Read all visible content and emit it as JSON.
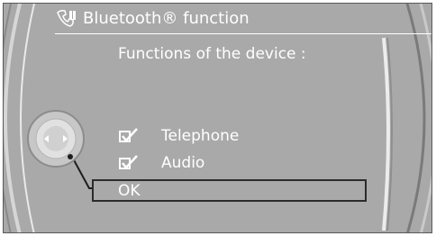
{
  "header": {
    "title": "Bluetooth® function",
    "icon": "phone-settings-icon"
  },
  "subtitle": "Functions of the device :",
  "options": [
    {
      "label": "Telephone",
      "checked": true,
      "icon": "checkbox-checked-icon"
    },
    {
      "label": "Audio",
      "checked": true,
      "icon": "checkbox-checked-icon"
    }
  ],
  "ok": {
    "label": "OK"
  },
  "colors": {
    "background": "#a9a9a9",
    "text": "#ffffff",
    "highlight_border": "#2b2b2b"
  }
}
